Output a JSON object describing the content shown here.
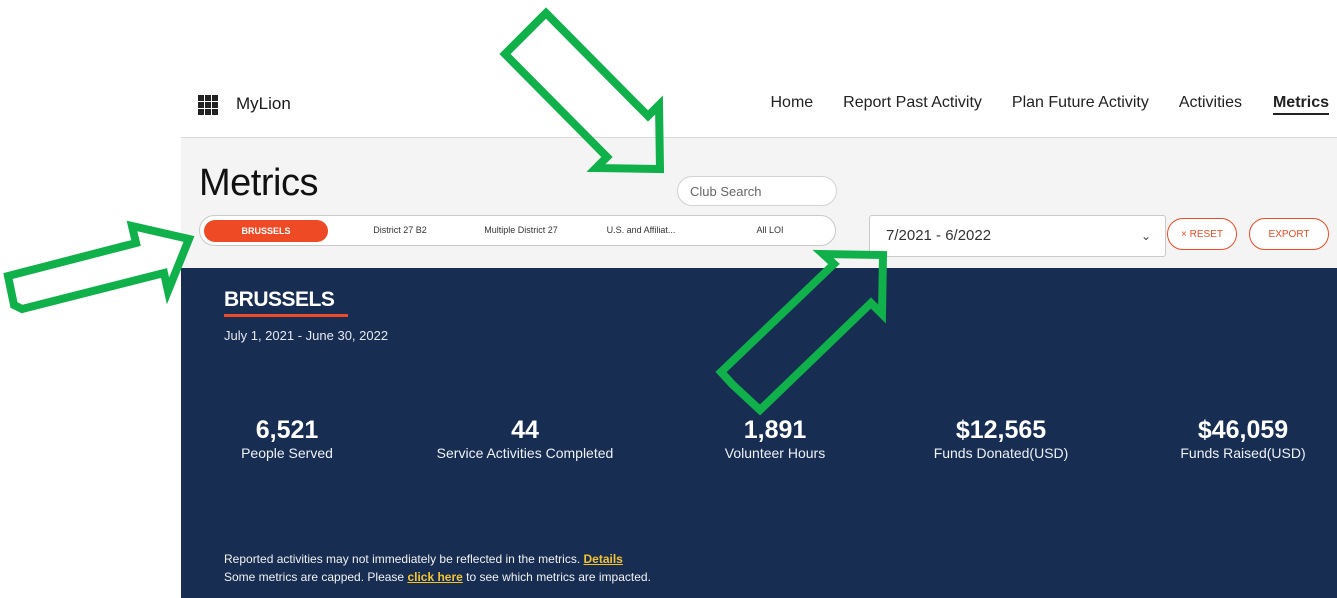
{
  "header": {
    "app_name": "MyLion",
    "nav": [
      {
        "label": "Home"
      },
      {
        "label": "Report Past Activity"
      },
      {
        "label": "Plan Future Activity"
      },
      {
        "label": "Activities"
      },
      {
        "label": "Metrics",
        "active": true
      }
    ]
  },
  "filters": {
    "page_title": "Metrics",
    "club_search_placeholder": "Club Search",
    "scope_tabs": [
      {
        "label": "BRUSSELS",
        "active": true
      },
      {
        "label": "District 27 B2"
      },
      {
        "label": "Multiple District 27"
      },
      {
        "label": "U.S. and Affiliat..."
      },
      {
        "label": "All LOI"
      }
    ],
    "period": "7/2021 - 6/2022",
    "reset_label": "× RESET",
    "export_label": "EXPORT"
  },
  "summary": {
    "club_name": "BRUSSELS",
    "period_text": "July 1, 2021 - June 30, 2022",
    "stats": [
      {
        "value": "6,521",
        "label": "People Served"
      },
      {
        "value": "44",
        "label": "Service Activities Completed"
      },
      {
        "value": "1,891",
        "label": "Volunteer Hours"
      },
      {
        "value": "$12,565",
        "label": "Funds Donated(USD)"
      },
      {
        "value": "$46,059",
        "label": "Funds Raised(USD)"
      }
    ],
    "note1_text": "Reported activities may not immediately be reflected in the metrics.",
    "note1_link": "Details",
    "note2_before": "Some metrics are capped. Please",
    "note2_link": "click here",
    "note2_after": "to see which metrics are impacted."
  },
  "colors": {
    "accent": "#ef4a26",
    "panel_bg": "#172d52",
    "link_yellow": "#f4c430",
    "arrow_green": "#10b04a"
  }
}
